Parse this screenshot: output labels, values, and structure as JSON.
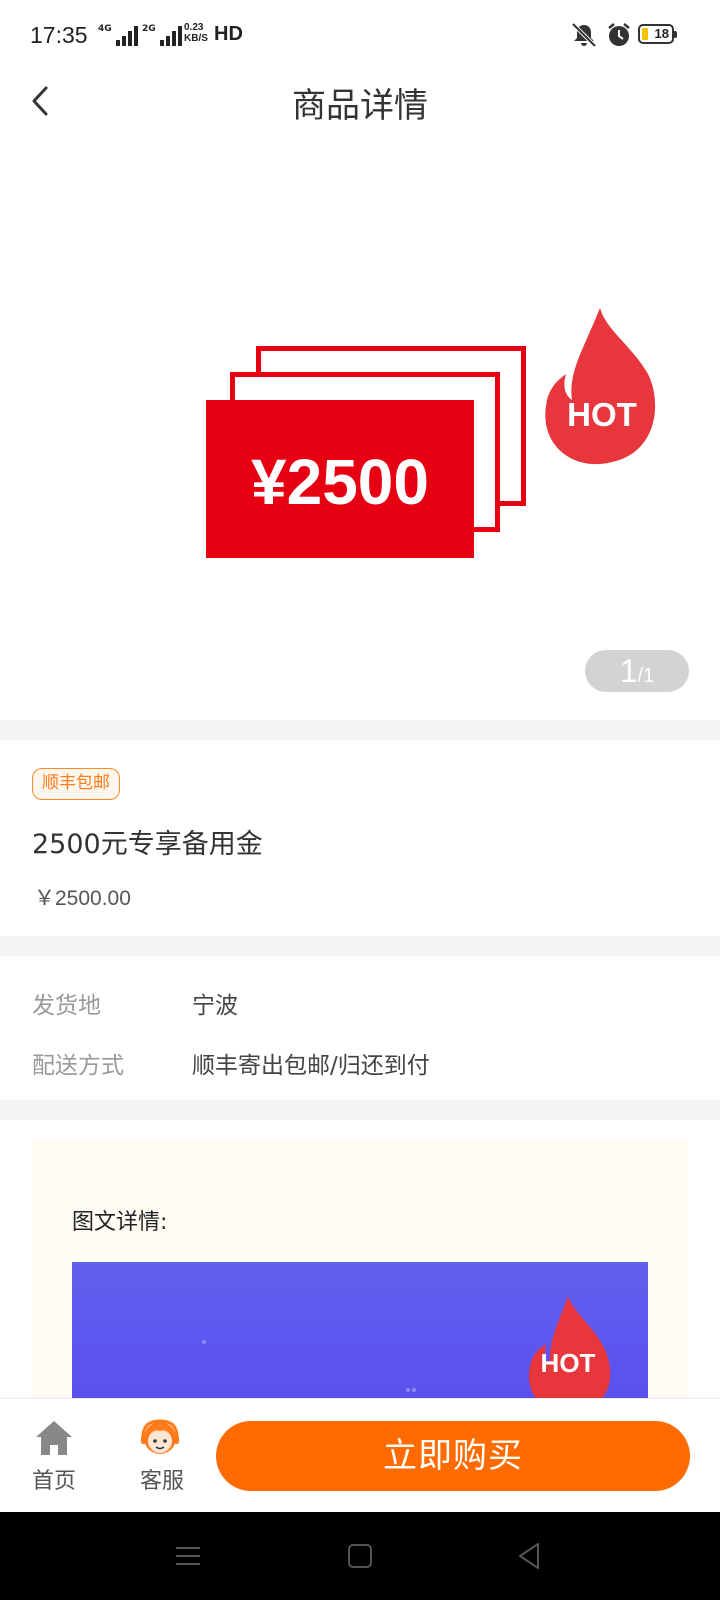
{
  "status_bar": {
    "time": "17:35",
    "signal_1_label": "4G",
    "signal_2_label": "2G",
    "net_speed_value": "0.23",
    "net_speed_unit": "KB/S",
    "hd_label": "HD",
    "battery_level": "18"
  },
  "header": {
    "title": "商品详情"
  },
  "banner": {
    "hot_label": "HOT",
    "card_text": "¥2500",
    "pager_current": "1",
    "pager_total": "/1"
  },
  "product": {
    "shipping_badge": "顺丰包邮",
    "name": "2500元专享备用金",
    "price": "￥2500.00"
  },
  "delivery": {
    "origin_label": "发货地",
    "origin_value": "宁波",
    "method_label": "配送方式",
    "method_value": "顺丰寄出包邮/归还到付"
  },
  "details": {
    "title": "图文详情:",
    "hot_label": "HOT"
  },
  "bottom_bar": {
    "home_label": "首页",
    "service_label": "客服",
    "buy_label": "立即购买"
  },
  "colors": {
    "accent": "#ff6b00",
    "card_red": "#e60012",
    "hot_red": "#e8373c",
    "badge_orange": "#ff7a1a"
  }
}
